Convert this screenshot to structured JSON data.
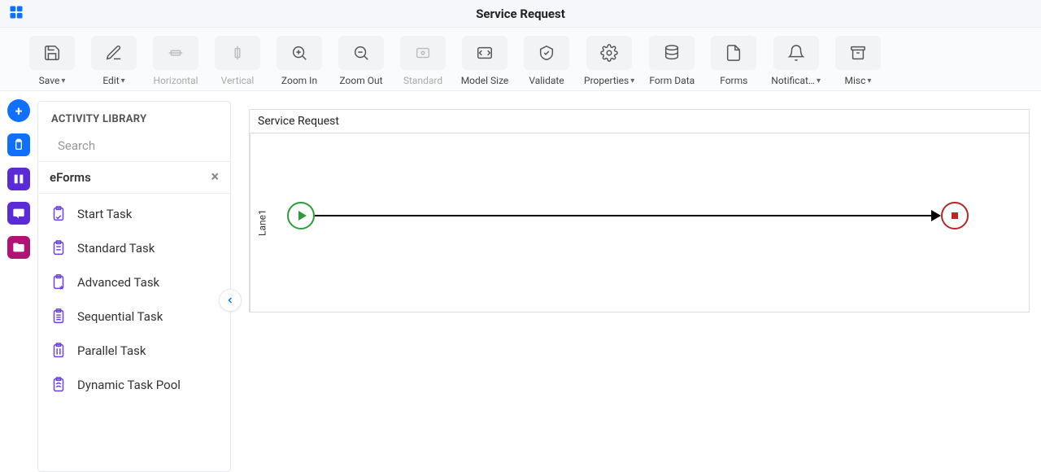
{
  "header": {
    "title": "Service Request"
  },
  "toolbar": [
    {
      "id": "save",
      "label": "Save",
      "dropdown": true,
      "disabled": false,
      "icon": "save"
    },
    {
      "id": "edit",
      "label": "Edit",
      "dropdown": true,
      "disabled": false,
      "icon": "edit"
    },
    {
      "id": "horizontal",
      "label": "Horizontal",
      "dropdown": false,
      "disabled": true,
      "icon": "align-h"
    },
    {
      "id": "vertical",
      "label": "Vertical",
      "dropdown": false,
      "disabled": true,
      "icon": "align-v"
    },
    {
      "id": "zoomin",
      "label": "Zoom In",
      "dropdown": false,
      "disabled": false,
      "icon": "zoom-in"
    },
    {
      "id": "zoomout",
      "label": "Zoom Out",
      "dropdown": false,
      "disabled": false,
      "icon": "zoom-out"
    },
    {
      "id": "standard",
      "label": "Standard",
      "dropdown": false,
      "disabled": true,
      "icon": "fit-standard"
    },
    {
      "id": "modelsize",
      "label": "Model Size",
      "dropdown": false,
      "disabled": false,
      "icon": "fit-model"
    },
    {
      "id": "validate",
      "label": "Validate",
      "dropdown": false,
      "disabled": false,
      "icon": "validate"
    },
    {
      "id": "properties",
      "label": "Properties",
      "dropdown": true,
      "disabled": false,
      "icon": "gear"
    },
    {
      "id": "formdata",
      "label": "Form Data",
      "dropdown": false,
      "disabled": false,
      "icon": "db"
    },
    {
      "id": "forms",
      "label": "Forms",
      "dropdown": false,
      "disabled": false,
      "icon": "doc"
    },
    {
      "id": "notifications",
      "label": "Notificat…",
      "dropdown": true,
      "disabled": false,
      "icon": "bell"
    },
    {
      "id": "misc",
      "label": "Misc",
      "dropdown": true,
      "disabled": false,
      "icon": "archive"
    }
  ],
  "rail": [
    {
      "id": "add",
      "style": "plus",
      "glyph": "+"
    },
    {
      "id": "clipboard",
      "style": "blue",
      "glyph": "clipboard"
    },
    {
      "id": "columns",
      "style": "purple",
      "glyph": "columns"
    },
    {
      "id": "chat",
      "style": "purple",
      "glyph": "chat"
    },
    {
      "id": "folder",
      "style": "magenta",
      "glyph": "folder"
    }
  ],
  "library": {
    "title": "ACTIVITY LIBRARY",
    "search_placeholder": "Search",
    "section": "eForms",
    "items": [
      "Start Task",
      "Standard Task",
      "Advanced Task",
      "Sequential Task",
      "Parallel Task",
      "Dynamic Task Pool"
    ]
  },
  "canvas": {
    "process_name": "Service Request",
    "lane_name": "Lane1"
  }
}
